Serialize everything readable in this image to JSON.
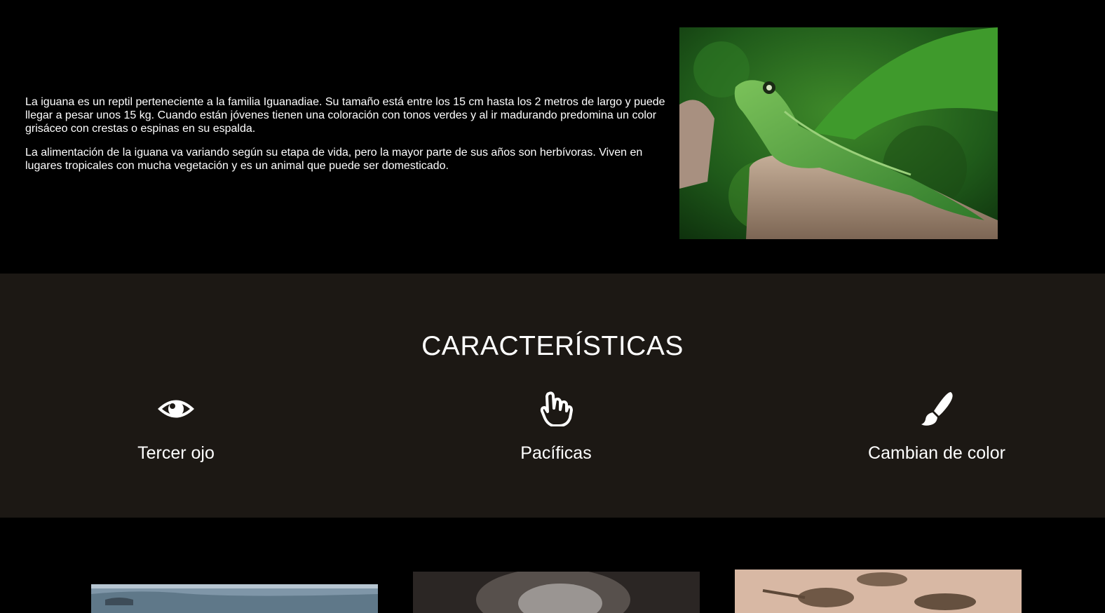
{
  "intro": {
    "paragraphs": [
      "La iguana es un reptil perteneciente a la familia Iguanadiae. Su tamaño está entre los 15 cm hasta los 2 metros de largo y puede llegar a pesar unos 15 kg. Cuando están jóvenes tienen una coloración con tonos verdes y al ir madurando predomina un color grisáceo con crestas o espinas en su espalda.",
      "La alimentación de la iguana va variando según su etapa de vida, pero la mayor parte de sus años son herbívoras. Viven en lugares tropicales con mucha vegetación y es un animal que puede ser domesticado."
    ]
  },
  "features": {
    "title": "CARACTERÍSTICAS",
    "items": [
      {
        "label": "Tercer ojo",
        "icon": "eye-icon"
      },
      {
        "label": "Pacíficas",
        "icon": "hand-pointer-icon"
      },
      {
        "label": "Cambian de color",
        "icon": "paint-brush-icon"
      }
    ]
  },
  "colors": {
    "background": "#000000",
    "features_background": "#1c1814",
    "text": "#ffffff"
  }
}
